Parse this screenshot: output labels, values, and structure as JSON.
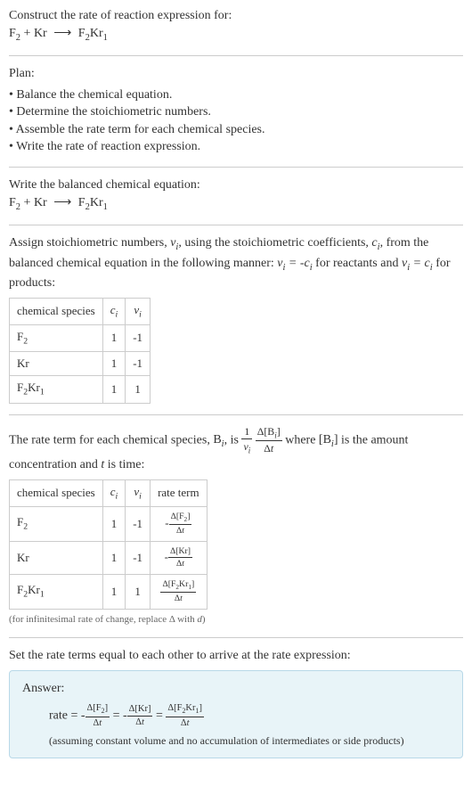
{
  "intro": {
    "title": "Construct the rate of reaction expression for:",
    "equation": "F₂ + Kr ⟶ F₂Kr₁"
  },
  "plan": {
    "title": "Plan:",
    "items": [
      "• Balance the chemical equation.",
      "• Determine the stoichiometric numbers.",
      "• Assemble the rate term for each chemical species.",
      "• Write the rate of reaction expression."
    ]
  },
  "balanced": {
    "title": "Write the balanced chemical equation:",
    "equation": "F₂ + Kr ⟶ F₂Kr₁"
  },
  "stoich": {
    "intro_a": "Assign stoichiometric numbers, ",
    "intro_b": ", using the stoichiometric coefficients, ",
    "intro_c": ", from the balanced chemical equation in the following manner: ",
    "intro_d": " for reactants and ",
    "intro_e": " for products:",
    "headers": {
      "species": "chemical species",
      "ci": "cᵢ",
      "vi": "νᵢ"
    },
    "rows": [
      {
        "species": "F₂",
        "ci": "1",
        "vi": "-1"
      },
      {
        "species": "Kr",
        "ci": "1",
        "vi": "-1"
      },
      {
        "species": "F₂Kr₁",
        "ci": "1",
        "vi": "1"
      }
    ]
  },
  "rateterm": {
    "intro_a": "The rate term for each chemical species, ",
    "intro_b": ", is ",
    "intro_c": " where ",
    "intro_d": " is the amount concentration and ",
    "intro_e": " is time:",
    "headers": {
      "species": "chemical species",
      "ci": "cᵢ",
      "vi": "νᵢ",
      "rate": "rate term"
    },
    "rows": [
      {
        "species": "F₂",
        "ci": "1",
        "vi": "-1",
        "rate_num": "Δ[F₂]",
        "rate_sign": "-"
      },
      {
        "species": "Kr",
        "ci": "1",
        "vi": "-1",
        "rate_num": "Δ[Kr]",
        "rate_sign": "-"
      },
      {
        "species": "F₂Kr₁",
        "ci": "1",
        "vi": "1",
        "rate_num": "Δ[F₂Kr₁]",
        "rate_sign": ""
      }
    ],
    "rate_den": "Δt",
    "note": "(for infinitesimal rate of change, replace Δ with d)"
  },
  "final": {
    "title": "Set the rate terms equal to each other to arrive at the rate expression:",
    "answer_label": "Answer:",
    "rate_prefix": "rate = ",
    "terms": [
      {
        "sign": "-",
        "num": "Δ[F₂]",
        "den": "Δt"
      },
      {
        "sign": "-",
        "num": "Δ[Kr]",
        "den": "Δt"
      },
      {
        "sign": "",
        "num": "Δ[F₂Kr₁]",
        "den": "Δt"
      }
    ],
    "eq": " = ",
    "assume": "(assuming constant volume and no accumulation of intermediates or side products)"
  }
}
